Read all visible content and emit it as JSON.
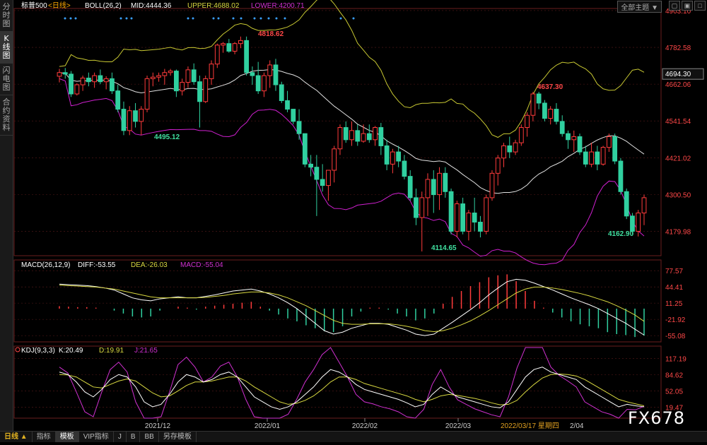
{
  "sidebar": {
    "tabs": [
      "分时图",
      "K线图",
      "闪电图",
      "合约资料"
    ],
    "active": 1
  },
  "header": {
    "symbol": "标普500",
    "period": "<日线>",
    "indicator": "BOLL(26,2)",
    "mid": "MID:4444.36",
    "upper": "UPPER:4688.02",
    "lower": "LOWER:4200.71",
    "theme_button": "全部主题",
    "theme_arrow": "▼"
  },
  "price_axis": {
    "ticks": [
      "4903.10",
      "4782.58",
      "4662.06",
      "4541.54",
      "4421.02",
      "4300.50",
      "4179.98"
    ],
    "current": "4694.30"
  },
  "annotations": {
    "high1": "4818.62",
    "low1": "4495.12",
    "high2": "4637.30",
    "low2": "4114.65",
    "low3": "4162.90"
  },
  "macd": {
    "title": "MACD(26,12,9)",
    "diff": "DIFF:-53.55",
    "dea": "DEA:-26.03",
    "macd": "MACD:-55.04",
    "ticks": [
      "77.57",
      "44.41",
      "11.25",
      "-21.92",
      "-55.08"
    ]
  },
  "kdj": {
    "title": "KDJ(9,3,3)",
    "k": "K:20.49",
    "d": "D:19.91",
    "j": "J:21.65",
    "ticks": [
      "117.19",
      "84.62",
      "52.05",
      "19.47"
    ]
  },
  "time_axis": {
    "labels": [
      "2021/12",
      "2022/01",
      "2022/02",
      "2022/03"
    ],
    "cursor": "2022/03/17 星期四",
    "cursor_tail": "2/04"
  },
  "bottom_bar": {
    "period_label": "日线 ▲",
    "tabs": [
      "指标",
      "模板",
      "VIP指标",
      "J",
      "B",
      "BB",
      "另存模板"
    ],
    "active": 1
  },
  "watermark": "FX678",
  "colors": {
    "up": "#ff3b3b",
    "down": "#30d0a0",
    "mid": "#e0e0e0",
    "upper": "#c8c832",
    "lower": "#d020d0",
    "bg": "#000000",
    "grid": "#5a1a1a"
  },
  "chart_data": [
    {
      "type": "candlestick",
      "title": "标普500 <日线>",
      "ylim": [
        4100,
        4910
      ],
      "x_labels": [
        "2021/12",
        "2022/01",
        "2022/02",
        "2022/03"
      ],
      "ohlc": [
        [
          4688,
          4712,
          4668,
          4700
        ],
        [
          4700,
          4715,
          4680,
          4695
        ],
        [
          4695,
          4705,
          4620,
          4630
        ],
        [
          4630,
          4665,
          4625,
          4660
        ],
        [
          4660,
          4690,
          4640,
          4682
        ],
        [
          4682,
          4700,
          4655,
          4670
        ],
        [
          4670,
          4700,
          4650,
          4690
        ],
        [
          4690,
          4710,
          4662,
          4670
        ],
        [
          4670,
          4688,
          4645,
          4680
        ],
        [
          4680,
          4700,
          4630,
          4640
        ],
        [
          4640,
          4660,
          4570,
          4580
        ],
        [
          4580,
          4605,
          4495,
          4510
        ],
        [
          4510,
          4590,
          4495,
          4575
        ],
        [
          4575,
          4600,
          4520,
          4540
        ],
        [
          4540,
          4590,
          4495,
          4580
        ],
        [
          4580,
          4690,
          4570,
          4680
        ],
        [
          4680,
          4700,
          4655,
          4685
        ],
        [
          4685,
          4700,
          4670,
          4690
        ],
        [
          4690,
          4712,
          4660,
          4700
        ],
        [
          4700,
          4712,
          4690,
          4705
        ],
        [
          4705,
          4710,
          4620,
          4640
        ],
        [
          4640,
          4680,
          4625,
          4668
        ],
        [
          4668,
          4720,
          4650,
          4709
        ],
        [
          4709,
          4730,
          4660,
          4670
        ],
        [
          4670,
          4690,
          4520,
          4605
        ],
        [
          4605,
          4690,
          4600,
          4680
        ],
        [
          4680,
          4740,
          4660,
          4728
        ],
        [
          4728,
          4795,
          4715,
          4790
        ],
        [
          4790,
          4800,
          4765,
          4795
        ],
        [
          4795,
          4810,
          4765,
          4770
        ],
        [
          4770,
          4800,
          4760,
          4795
        ],
        [
          4795,
          4818,
          4780,
          4805
        ],
        [
          4805,
          4818,
          4690,
          4700
        ],
        [
          4700,
          4720,
          4660,
          4690
        ],
        [
          4690,
          4735,
          4630,
          4640
        ],
        [
          4640,
          4700,
          4620,
          4690
        ],
        [
          4690,
          4740,
          4650,
          4725
        ],
        [
          4725,
          4745,
          4640,
          4660
        ],
        [
          4660,
          4670,
          4600,
          4608
        ],
        [
          4608,
          4640,
          4570,
          4580
        ],
        [
          4580,
          4580,
          4530,
          4540
        ],
        [
          4540,
          4580,
          4480,
          4500
        ],
        [
          4500,
          4500,
          4390,
          4400
        ],
        [
          4400,
          4430,
          4360,
          4390
        ],
        [
          4390,
          4430,
          4230,
          4350
        ],
        [
          4350,
          4400,
          4310,
          4330
        ],
        [
          4330,
          4380,
          4280,
          4380
        ],
        [
          4380,
          4460,
          4340,
          4450
        ],
        [
          4450,
          4530,
          4430,
          4520
        ],
        [
          4520,
          4540,
          4470,
          4480
        ],
        [
          4480,
          4540,
          4460,
          4510
        ],
        [
          4510,
          4530,
          4460,
          4475
        ],
        [
          4475,
          4530,
          4470,
          4500
        ],
        [
          4500,
          4530,
          4470,
          4480
        ],
        [
          4480,
          4525,
          4460,
          4520
        ],
        [
          4520,
          4535,
          4430,
          4460
        ],
        [
          4460,
          4480,
          4380,
          4400
        ],
        [
          4400,
          4450,
          4370,
          4440
        ],
        [
          4440,
          4460,
          4390,
          4410
        ],
        [
          4410,
          4430,
          4350,
          4360
        ],
        [
          4360,
          4380,
          4280,
          4290
        ],
        [
          4290,
          4320,
          4200,
          4225
        ],
        [
          4225,
          4310,
          4114,
          4290
        ],
        [
          4290,
          4370,
          4230,
          4350
        ],
        [
          4350,
          4380,
          4240,
          4300
        ],
        [
          4300,
          4390,
          4250,
          4370
        ],
        [
          4370,
          4390,
          4290,
          4310
        ],
        [
          4310,
          4320,
          4170,
          4180
        ],
        [
          4180,
          4280,
          4160,
          4270
        ],
        [
          4270,
          4290,
          4170,
          4180
        ],
        [
          4180,
          4250,
          4150,
          4240
        ],
        [
          4240,
          4290,
          4180,
          4210
        ],
        [
          4210,
          4230,
          4160,
          4180
        ],
        [
          4180,
          4300,
          4170,
          4290
        ],
        [
          4290,
          4380,
          4280,
          4370
        ],
        [
          4370,
          4430,
          4330,
          4420
        ],
        [
          4420,
          4470,
          4390,
          4460
        ],
        [
          4460,
          4490,
          4420,
          4440
        ],
        [
          4440,
          4480,
          4430,
          4470
        ],
        [
          4470,
          4530,
          4460,
          4520
        ],
        [
          4520,
          4570,
          4490,
          4560
        ],
        [
          4560,
          4637,
          4540,
          4630
        ],
        [
          4630,
          4637,
          4580,
          4600
        ],
        [
          4600,
          4610,
          4540,
          4550
        ],
        [
          4550,
          4590,
          4530,
          4580
        ],
        [
          4580,
          4600,
          4530,
          4540
        ],
        [
          4540,
          4560,
          4490,
          4500
        ],
        [
          4500,
          4510,
          4450,
          4480
        ],
        [
          4480,
          4510,
          4440,
          4490
        ],
        [
          4490,
          4500,
          4430,
          4440
        ],
        [
          4440,
          4460,
          4390,
          4400
        ],
        [
          4400,
          4470,
          4390,
          4440
        ],
        [
          4440,
          4460,
          4380,
          4400
        ],
        [
          4400,
          4460,
          4395,
          4455
        ],
        [
          4455,
          4500,
          4440,
          4490
        ],
        [
          4490,
          4500,
          4400,
          4410
        ],
        [
          4410,
          4420,
          4300,
          4310
        ],
        [
          4310,
          4320,
          4220,
          4230
        ],
        [
          4230,
          4240,
          4170,
          4180
        ],
        [
          4180,
          4250,
          4163,
          4240
        ],
        [
          4240,
          4300,
          4200,
          4290
        ]
      ],
      "overlay_label": "BOLL(26,2)"
    },
    {
      "type": "bar",
      "title": "MACD(26,12,9)",
      "ylim": [
        -65,
        85
      ],
      "tick_values": [
        77.57,
        44.41,
        11.25,
        -21.92,
        -55.08
      ],
      "diff": [
        50,
        49,
        48,
        47,
        45,
        42,
        38,
        30,
        22,
        18,
        16,
        20,
        22,
        24,
        22,
        22,
        25,
        28,
        32,
        36,
        38,
        40,
        36,
        30,
        22,
        12,
        0,
        -15,
        -30,
        -45,
        -52,
        -48,
        -40,
        -35,
        -30,
        -30,
        -32,
        -38,
        -44,
        -52,
        -55,
        -52,
        -40,
        -28,
        -15,
        -2,
        12,
        28,
        42,
        55,
        60,
        58,
        52,
        45,
        38,
        30,
        22,
        15,
        8,
        0,
        -10,
        -20,
        -30,
        -42,
        -54
      ],
      "dea": [
        48,
        47,
        46,
        45,
        44,
        42,
        40,
        36,
        32,
        28,
        24,
        22,
        22,
        22,
        22,
        22,
        23,
        25,
        27,
        30,
        32,
        34,
        34,
        32,
        28,
        22,
        14,
        6,
        -4,
        -14,
        -24,
        -30,
        -32,
        -32,
        -31,
        -31,
        -31,
        -33,
        -36,
        -40,
        -45,
        -47,
        -45,
        -40,
        -33,
        -25,
        -15,
        -4,
        8,
        20,
        32,
        40,
        44,
        44,
        42,
        39,
        35,
        31,
        26,
        20,
        14,
        6,
        -3,
        -13,
        -26
      ],
      "histogram": [
        5,
        4,
        3,
        3,
        2,
        0,
        -4,
        -10,
        -16,
        -18,
        -16,
        -4,
        0,
        4,
        2,
        -2,
        4,
        6,
        8,
        10,
        12,
        14,
        4,
        -4,
        -12,
        -20,
        -26,
        -34,
        -40,
        -46,
        -48,
        -36,
        -16,
        -6,
        2,
        2,
        -2,
        -10,
        -16,
        -24,
        -20,
        -10,
        10,
        24,
        36,
        46,
        54,
        64,
        68,
        70,
        56,
        36,
        16,
        2,
        -8,
        -18,
        -26,
        -32,
        -36,
        -40,
        -48,
        -52,
        -54,
        -58,
        -55
      ]
    },
    {
      "type": "line",
      "title": "KDJ(9,3,3)",
      "ylim": [
        0,
        128
      ],
      "tick_values": [
        117.19,
        84.62,
        52.05,
        19.47
      ],
      "k": [
        90,
        85,
        70,
        50,
        40,
        55,
        75,
        85,
        80,
        60,
        30,
        20,
        25,
        45,
        70,
        85,
        80,
        70,
        75,
        85,
        90,
        80,
        60,
        40,
        30,
        20,
        15,
        20,
        30,
        45,
        60,
        80,
        95,
        90,
        80,
        65,
        55,
        50,
        45,
        40,
        35,
        28,
        20,
        25,
        45,
        60,
        50,
        40,
        35,
        30,
        25,
        20,
        18,
        30,
        55,
        80,
        95,
        100,
        90,
        85,
        80,
        75,
        60,
        50,
        40,
        30,
        20,
        25,
        22,
        20
      ],
      "d": [
        85,
        84,
        80,
        70,
        60,
        58,
        65,
        72,
        76,
        72,
        60,
        48,
        40,
        42,
        52,
        63,
        70,
        70,
        72,
        76,
        80,
        80,
        72,
        60,
        50,
        40,
        30,
        25,
        27,
        33,
        42,
        55,
        70,
        80,
        80,
        75,
        67,
        62,
        57,
        52,
        47,
        42,
        35,
        30,
        35,
        42,
        45,
        43,
        40,
        37,
        33,
        28,
        24,
        25,
        33,
        50,
        65,
        78,
        85,
        86,
        85,
        82,
        75,
        65,
        55,
        45,
        35,
        30,
        26,
        22
      ],
      "j": [
        100,
        88,
        50,
        10,
        0,
        50,
        95,
        110,
        90,
        30,
        -10,
        -15,
        0,
        50,
        105,
        120,
        100,
        70,
        80,
        102,
        110,
        80,
        35,
        0,
        -10,
        -10,
        -15,
        5,
        35,
        70,
        95,
        125,
        140,
        110,
        80,
        45,
        30,
        26,
        20,
        16,
        10,
        0,
        -10,
        15,
        65,
        95,
        60,
        34,
        25,
        16,
        10,
        4,
        0,
        40,
        98,
        140,
        150,
        140,
        100,
        83,
        72,
        60,
        30,
        20,
        10,
        5,
        -5,
        15,
        14,
        21
      ]
    }
  ]
}
